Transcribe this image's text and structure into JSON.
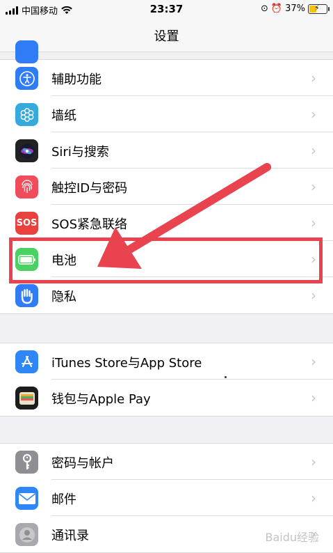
{
  "status_bar": {
    "carrier": "中国移动",
    "time": "23:37",
    "battery_percent": "37%"
  },
  "nav": {
    "title": "设置"
  },
  "group1": [
    {
      "label": "辅助功能",
      "icon": "accessibility-icon",
      "color": "#2f7cf6"
    },
    {
      "label": "墙纸",
      "icon": "wallpaper-icon",
      "color": "#36aadc"
    },
    {
      "label": "Siri与搜索",
      "icon": "siri-icon",
      "color": "#222222"
    },
    {
      "label": "触控ID与密码",
      "icon": "fingerprint-icon",
      "color": "#f04c5b"
    },
    {
      "label": "SOS紧急联络",
      "icon": "sos-icon",
      "color": "#e9413e",
      "icon_text": "SOS"
    },
    {
      "label": "电池",
      "icon": "battery-icon",
      "color": "#4ad161"
    },
    {
      "label": "隐私",
      "icon": "privacy-hand-icon",
      "color": "#2f7cf6"
    }
  ],
  "group2": [
    {
      "label": "iTunes Store与App Store",
      "icon": "app-store-icon",
      "color": "#2f86f6"
    },
    {
      "label": "钱包与Apple Pay",
      "icon": "wallet-icon",
      "color": "#1c1c1c"
    }
  ],
  "group3": [
    {
      "label": "密码与帐户",
      "icon": "key-icon",
      "color": "#8e8e93"
    },
    {
      "label": "邮件",
      "icon": "mail-icon",
      "color": "#2f86f6"
    },
    {
      "label": "通讯录",
      "icon": "contacts-icon",
      "color": "#a8a8ad"
    }
  ],
  "watermark": "Baidu经验",
  "colors": {
    "annotation": "#e8434f"
  }
}
